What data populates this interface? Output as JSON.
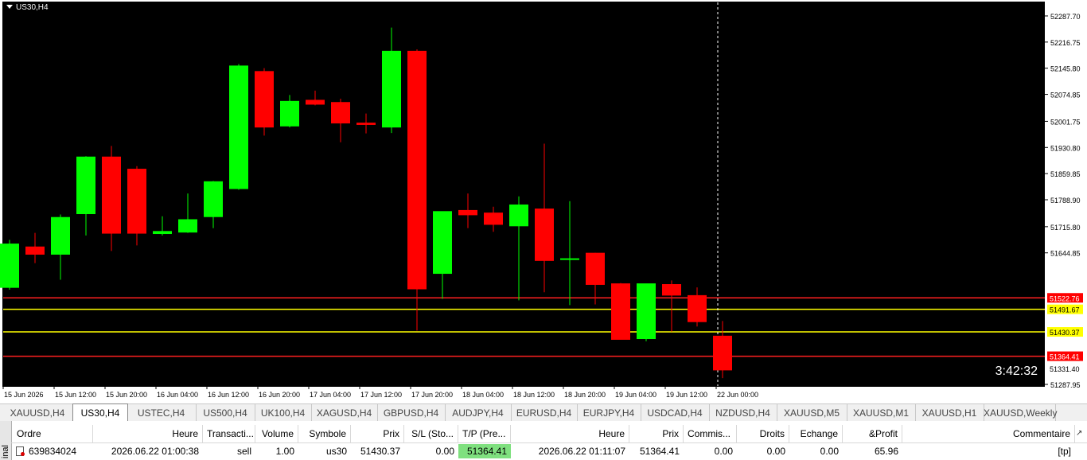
{
  "chart": {
    "symbol_label": "US30,H4",
    "countdown": "3:42:32",
    "price_axis": [
      "52287.70",
      "52216.75",
      "52145.80",
      "52074.85",
      "52001.75",
      "51930.80",
      "51859.85",
      "51788.90",
      "51715.80",
      "51644.85",
      "51287.95"
    ],
    "price_labels_colored": [
      {
        "text": "51522.76",
        "color": "#ff0000",
        "line": "#ff2020"
      },
      {
        "text": "51491.67",
        "color": "#ffff00",
        "line": "#ffff00"
      },
      {
        "text": "51430.37",
        "color": "#ffff00",
        "line": "#ffff00"
      },
      {
        "text": "51364.41",
        "color": "#ff0000",
        "line": "#ff2020"
      },
      {
        "text": "51331.40",
        "color": "#ffffff",
        "line": "none"
      }
    ],
    "time_axis": [
      "15 Jun 2026",
      "15 Jun 12:00",
      "15 Jun 20:00",
      "16 Jun 04:00",
      "16 Jun 12:00",
      "16 Jun 20:00",
      "17 Jun 04:00",
      "17 Jun 12:00",
      "17 Jun 20:00",
      "18 Jun 04:00",
      "18 Jun 12:00",
      "18 Jun 20:00",
      "19 Jun 04:00",
      "19 Jun 12:00",
      "22 Jun 00:00"
    ],
    "up_color": "#00ff00",
    "down_color": "#ff0000",
    "candles": [
      {
        "o": 51550,
        "h": 51680,
        "l": 51545,
        "c": 51670
      },
      {
        "o": 51662,
        "h": 51699,
        "l": 51617,
        "c": 51640
      },
      {
        "o": 51640,
        "h": 51749,
        "l": 51572,
        "c": 51742
      },
      {
        "o": 51750,
        "h": 51907,
        "l": 51692,
        "c": 51906
      },
      {
        "o": 51906,
        "h": 51935,
        "l": 51650,
        "c": 51697
      },
      {
        "o": 51873,
        "h": 51880,
        "l": 51665,
        "c": 51697
      },
      {
        "o": 51696,
        "h": 51744,
        "l": 51692,
        "c": 51704
      },
      {
        "o": 51700,
        "h": 51806,
        "l": 51699,
        "c": 51736
      },
      {
        "o": 51742,
        "h": 51840,
        "l": 51712,
        "c": 51839
      },
      {
        "o": 51818,
        "h": 52157,
        "l": 51816,
        "c": 52153
      },
      {
        "o": 52138,
        "h": 52146,
        "l": 51963,
        "c": 51985
      },
      {
        "o": 51988,
        "h": 52073,
        "l": 51985,
        "c": 52057
      },
      {
        "o": 52060,
        "h": 52085,
        "l": 52045,
        "c": 52047
      },
      {
        "o": 52054,
        "h": 52063,
        "l": 51945,
        "c": 51996
      },
      {
        "o": 51998,
        "h": 52023,
        "l": 51969,
        "c": 51992
      },
      {
        "o": 51985,
        "h": 52256,
        "l": 51970,
        "c": 52193
      },
      {
        "o": 52193,
        "h": 52197,
        "l": 51434,
        "c": 51546
      },
      {
        "o": 51588,
        "h": 51740,
        "l": 51520,
        "c": 51758
      },
      {
        "o": 51761,
        "h": 51806,
        "l": 51712,
        "c": 51747
      },
      {
        "o": 51754,
        "h": 51770,
        "l": 51702,
        "c": 51721
      },
      {
        "o": 51717,
        "h": 51798,
        "l": 51516,
        "c": 51776
      },
      {
        "o": 51765,
        "h": 51941,
        "l": 51538,
        "c": 51623
      },
      {
        "o": 51628,
        "h": 51785,
        "l": 51503,
        "c": 51630
      },
      {
        "o": 51645,
        "h": 51645,
        "l": 51505,
        "c": 51558
      },
      {
        "o": 51562,
        "h": 51563,
        "l": 51438,
        "c": 51409
      },
      {
        "o": 51411,
        "h": 51560,
        "l": 51405,
        "c": 51562
      },
      {
        "o": 51560,
        "h": 51570,
        "l": 51431,
        "c": 51529
      },
      {
        "o": 51530,
        "h": 51551,
        "l": 51445,
        "c": 51457
      },
      {
        "o": 51420,
        "h": 51460,
        "l": 51305,
        "c": 51326
      }
    ],
    "y_min": 51287.95,
    "y_max": 52287.7
  },
  "tabs": [
    "XAUUSD,H4",
    "US30,H4",
    "USTEC,H4",
    "US500,H4",
    "UK100,H4",
    "XAGUSD,H4",
    "GBPUSD,H4",
    "AUDJPY,H4",
    "EURUSD,H4",
    "EURJPY,H4",
    "USDCAD,H4",
    "NZDUSD,H4",
    "XAUUSD,M5",
    "XAUUSD,M1",
    "XAUUSD,H1",
    "XAUUSD,Weekly"
  ],
  "active_tab": "US30,H4",
  "terminal": {
    "side_label": "inal",
    "headers": [
      "Ordre",
      "Heure",
      "Transacti...",
      "Volume",
      "Symbole",
      "Prix",
      "S/L (Sto...",
      "T/P (Pre...",
      "Heure",
      "Prix",
      "Commis...",
      "Droits",
      "Echange",
      "&Profit",
      "Commentaire"
    ],
    "row": [
      "639834024",
      "2026.06.22 01:00:38",
      "sell",
      "1.00",
      "us30",
      "51430.37",
      "0.00",
      "51364.41",
      "2026.06.22 01:11:07",
      "51364.41",
      "0.00",
      "0.00",
      "0.00",
      "65.96",
      "[tp]"
    ]
  }
}
